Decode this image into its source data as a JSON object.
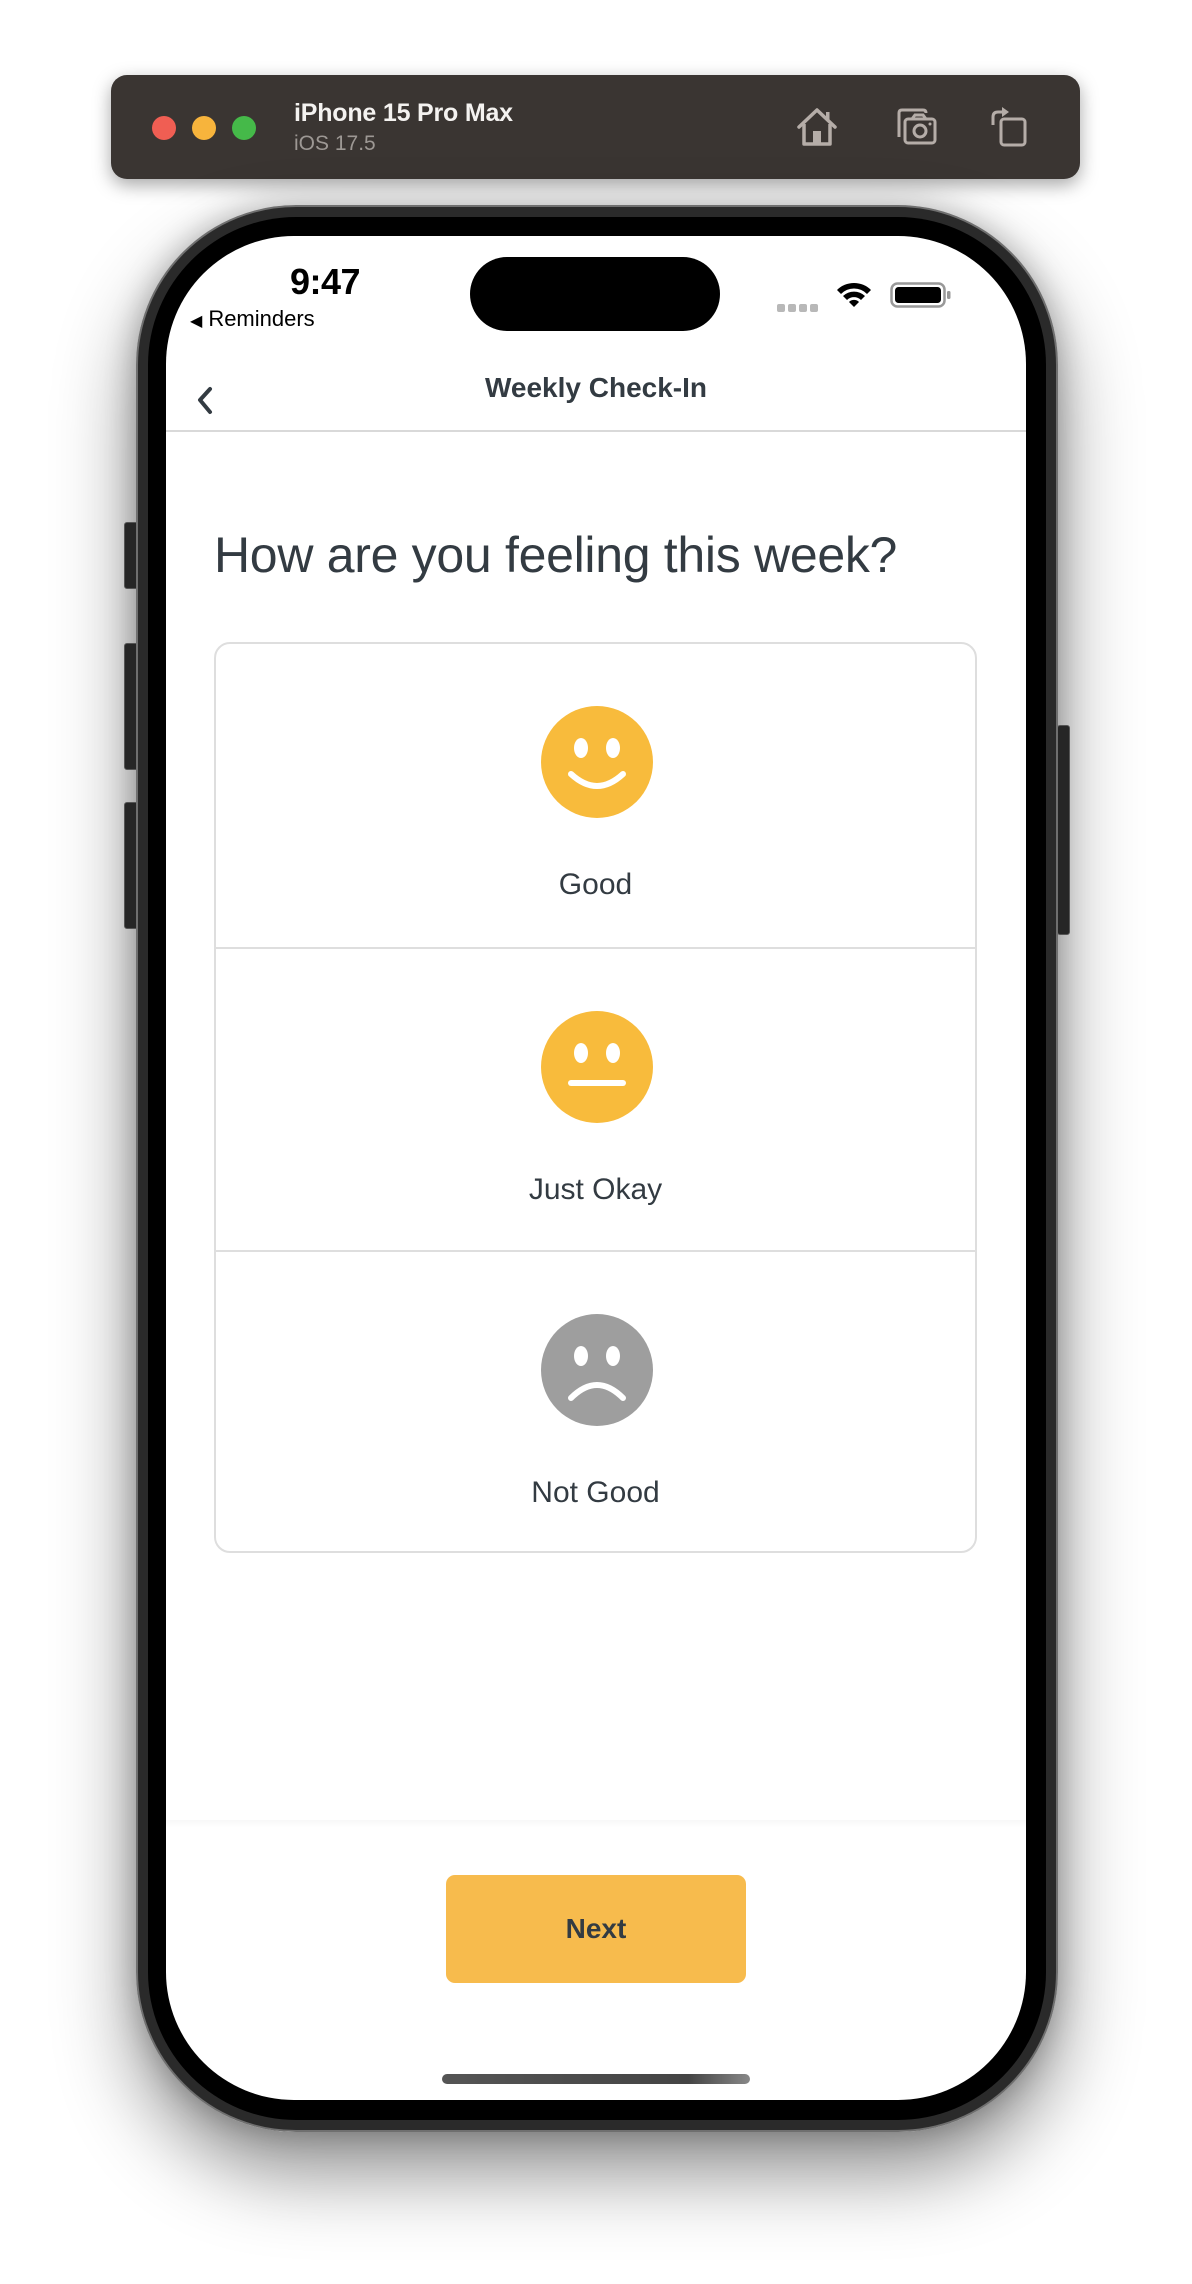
{
  "simulator": {
    "device_name": "iPhone 15 Pro Max",
    "os_version": "iOS 17.5",
    "toolbar_icons": [
      "home-icon",
      "screenshot-icon",
      "rotate-icon"
    ]
  },
  "status_bar": {
    "time": "9:47",
    "back_app": "Reminders",
    "back_app_glyph": "◀"
  },
  "nav": {
    "title": "Weekly Check-In",
    "back_glyph": "‹"
  },
  "question": "How are you feeling this week?",
  "options": [
    {
      "label": "Good",
      "icon": "smile-face-icon",
      "color": "#f8bb3c"
    },
    {
      "label": "Just Okay",
      "icon": "neutral-face-icon",
      "color": "#f8bb3c"
    },
    {
      "label": "Not Good",
      "icon": "sad-face-icon",
      "color": "#9e9e9e"
    }
  ],
  "footer": {
    "next_label": "Next",
    "next_color": "#f7bb4d"
  },
  "colors": {
    "text": "#333b42",
    "accent": "#f7bb4d",
    "border": "#dedede",
    "toolbar_bg": "#3a3532"
  }
}
